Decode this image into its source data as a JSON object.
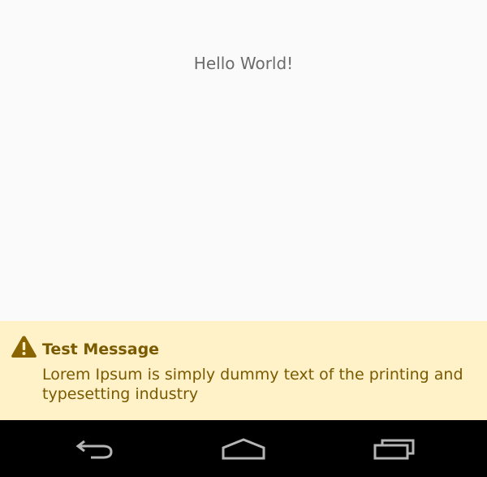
{
  "content": {
    "greeting": "Hello World!"
  },
  "banner": {
    "icon": "warning-triangle-icon",
    "title": "Test Message",
    "body": "Lorem Ipsum is simply dummy text of the printing and typesetting industry",
    "colors": {
      "background": "#fff1c8",
      "text": "#7a5a00",
      "icon": "#8a6400"
    }
  },
  "navbar": {
    "buttons": [
      {
        "icon": "back-icon"
      },
      {
        "icon": "home-icon"
      },
      {
        "icon": "recent-apps-icon"
      }
    ],
    "colors": {
      "background": "#000000",
      "icon": "#b5b5b5"
    }
  }
}
